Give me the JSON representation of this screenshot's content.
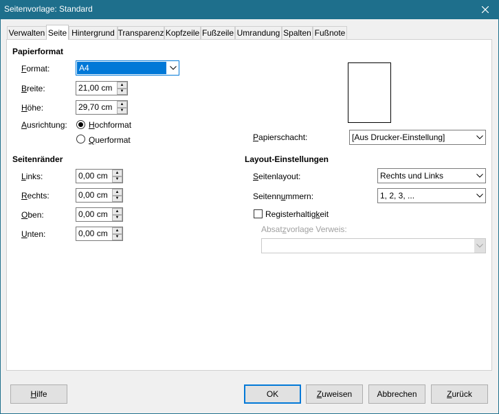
{
  "window": {
    "title": "Seitenvorlage: Standard",
    "close_icon": "close-icon"
  },
  "tabs": [
    {
      "label": "Verwalten",
      "active": false
    },
    {
      "label": "Seite",
      "active": true
    },
    {
      "label": "Hintergrund",
      "active": false
    },
    {
      "label": "Transparenz",
      "active": false
    },
    {
      "label": "Kopfzeile",
      "active": false
    },
    {
      "label": "Fußzeile",
      "active": false
    },
    {
      "label": "Umrandung",
      "active": false
    },
    {
      "label": "Spalten",
      "active": false
    },
    {
      "label": "Fußnote",
      "active": false
    }
  ],
  "papierformat": {
    "title": "Papierformat",
    "format_label_u": "F",
    "format_label_rest": "ormat:",
    "format_value": "A4",
    "breite_label_u": "B",
    "breite_label_rest": "reite:",
    "breite_value": "21,00 cm",
    "hoehe_label_u": "H",
    "hoehe_label_rest": "öhe:",
    "hoehe_value": "29,70 cm",
    "ausrichtung_label_u": "A",
    "ausrichtung_label_rest": "usrichtung:",
    "hochformat_u": "H",
    "hochformat_rest": "ochformat",
    "hochformat_selected": true,
    "querformat_u": "Q",
    "querformat_rest": "uerformat",
    "querformat_selected": false,
    "papierschacht_label_u": "P",
    "papierschacht_label_rest": "apierschacht:",
    "papierschacht_value": "[Aus Drucker-Einstellung]"
  },
  "seitenraender": {
    "title": "Seitenränder",
    "links_u": "L",
    "links_rest": "inks:",
    "links_value": "0,00 cm",
    "rechts_u": "R",
    "rechts_rest": "echts:",
    "rechts_value": "0,00 cm",
    "oben_u": "O",
    "oben_rest": "ben:",
    "oben_value": "0,00 cm",
    "unten_u": "U",
    "unten_rest": "nten:",
    "unten_value": "0,00 cm"
  },
  "layout": {
    "title": "Layout-Einstellungen",
    "seitenlayout_u": "S",
    "seitenlayout_rest": "eitenlayout:",
    "seitenlayout_value": "Rechts und Links",
    "seitennummern_pre": "Seitenn",
    "seitennummern_u": "u",
    "seitennummern_rest": "mmern:",
    "seitennummern_value": "1, 2, 3, ...",
    "registerhaltigkeit_pre": "Registerhaltig",
    "registerhaltigkeit_u": "k",
    "registerhaltigkeit_rest": "eit",
    "registerhaltigkeit_checked": false,
    "absatzvorlage_pre": "Absat",
    "absatzvorlage_u": "z",
    "absatzvorlage_rest": "vorlage Verweis:",
    "absatzvorlage_value": ""
  },
  "buttons": {
    "hilfe_u": "H",
    "hilfe_rest": "ilfe",
    "ok": "OK",
    "zuweisen_u": "Z",
    "zuweisen_rest": "uweisen",
    "abbrechen": "Abbrechen",
    "zurueck_u": "Z",
    "zurueck_rest": "urück"
  }
}
